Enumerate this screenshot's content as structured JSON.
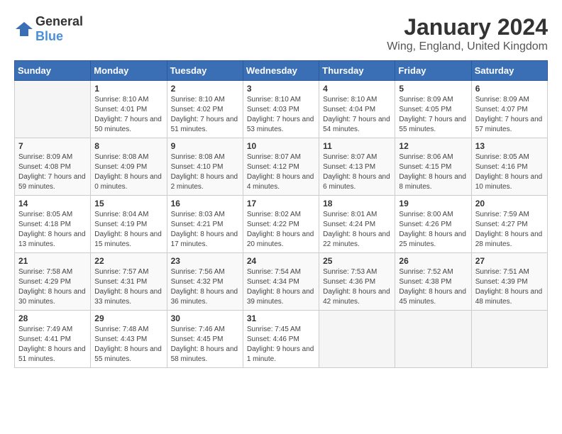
{
  "logo": {
    "general": "General",
    "blue": "Blue"
  },
  "title": "January 2024",
  "subtitle": "Wing, England, United Kingdom",
  "days_of_week": [
    "Sunday",
    "Monday",
    "Tuesday",
    "Wednesday",
    "Thursday",
    "Friday",
    "Saturday"
  ],
  "weeks": [
    [
      {
        "day": "",
        "sunrise": "",
        "sunset": "",
        "daylight": ""
      },
      {
        "day": "1",
        "sunrise": "Sunrise: 8:10 AM",
        "sunset": "Sunset: 4:01 PM",
        "daylight": "Daylight: 7 hours and 50 minutes."
      },
      {
        "day": "2",
        "sunrise": "Sunrise: 8:10 AM",
        "sunset": "Sunset: 4:02 PM",
        "daylight": "Daylight: 7 hours and 51 minutes."
      },
      {
        "day": "3",
        "sunrise": "Sunrise: 8:10 AM",
        "sunset": "Sunset: 4:03 PM",
        "daylight": "Daylight: 7 hours and 53 minutes."
      },
      {
        "day": "4",
        "sunrise": "Sunrise: 8:10 AM",
        "sunset": "Sunset: 4:04 PM",
        "daylight": "Daylight: 7 hours and 54 minutes."
      },
      {
        "day": "5",
        "sunrise": "Sunrise: 8:09 AM",
        "sunset": "Sunset: 4:05 PM",
        "daylight": "Daylight: 7 hours and 55 minutes."
      },
      {
        "day": "6",
        "sunrise": "Sunrise: 8:09 AM",
        "sunset": "Sunset: 4:07 PM",
        "daylight": "Daylight: 7 hours and 57 minutes."
      }
    ],
    [
      {
        "day": "7",
        "sunrise": "Sunrise: 8:09 AM",
        "sunset": "Sunset: 4:08 PM",
        "daylight": "Daylight: 7 hours and 59 minutes."
      },
      {
        "day": "8",
        "sunrise": "Sunrise: 8:08 AM",
        "sunset": "Sunset: 4:09 PM",
        "daylight": "Daylight: 8 hours and 0 minutes."
      },
      {
        "day": "9",
        "sunrise": "Sunrise: 8:08 AM",
        "sunset": "Sunset: 4:10 PM",
        "daylight": "Daylight: 8 hours and 2 minutes."
      },
      {
        "day": "10",
        "sunrise": "Sunrise: 8:07 AM",
        "sunset": "Sunset: 4:12 PM",
        "daylight": "Daylight: 8 hours and 4 minutes."
      },
      {
        "day": "11",
        "sunrise": "Sunrise: 8:07 AM",
        "sunset": "Sunset: 4:13 PM",
        "daylight": "Daylight: 8 hours and 6 minutes."
      },
      {
        "day": "12",
        "sunrise": "Sunrise: 8:06 AM",
        "sunset": "Sunset: 4:15 PM",
        "daylight": "Daylight: 8 hours and 8 minutes."
      },
      {
        "day": "13",
        "sunrise": "Sunrise: 8:05 AM",
        "sunset": "Sunset: 4:16 PM",
        "daylight": "Daylight: 8 hours and 10 minutes."
      }
    ],
    [
      {
        "day": "14",
        "sunrise": "Sunrise: 8:05 AM",
        "sunset": "Sunset: 4:18 PM",
        "daylight": "Daylight: 8 hours and 13 minutes."
      },
      {
        "day": "15",
        "sunrise": "Sunrise: 8:04 AM",
        "sunset": "Sunset: 4:19 PM",
        "daylight": "Daylight: 8 hours and 15 minutes."
      },
      {
        "day": "16",
        "sunrise": "Sunrise: 8:03 AM",
        "sunset": "Sunset: 4:21 PM",
        "daylight": "Daylight: 8 hours and 17 minutes."
      },
      {
        "day": "17",
        "sunrise": "Sunrise: 8:02 AM",
        "sunset": "Sunset: 4:22 PM",
        "daylight": "Daylight: 8 hours and 20 minutes."
      },
      {
        "day": "18",
        "sunrise": "Sunrise: 8:01 AM",
        "sunset": "Sunset: 4:24 PM",
        "daylight": "Daylight: 8 hours and 22 minutes."
      },
      {
        "day": "19",
        "sunrise": "Sunrise: 8:00 AM",
        "sunset": "Sunset: 4:26 PM",
        "daylight": "Daylight: 8 hours and 25 minutes."
      },
      {
        "day": "20",
        "sunrise": "Sunrise: 7:59 AM",
        "sunset": "Sunset: 4:27 PM",
        "daylight": "Daylight: 8 hours and 28 minutes."
      }
    ],
    [
      {
        "day": "21",
        "sunrise": "Sunrise: 7:58 AM",
        "sunset": "Sunset: 4:29 PM",
        "daylight": "Daylight: 8 hours and 30 minutes."
      },
      {
        "day": "22",
        "sunrise": "Sunrise: 7:57 AM",
        "sunset": "Sunset: 4:31 PM",
        "daylight": "Daylight: 8 hours and 33 minutes."
      },
      {
        "day": "23",
        "sunrise": "Sunrise: 7:56 AM",
        "sunset": "Sunset: 4:32 PM",
        "daylight": "Daylight: 8 hours and 36 minutes."
      },
      {
        "day": "24",
        "sunrise": "Sunrise: 7:54 AM",
        "sunset": "Sunset: 4:34 PM",
        "daylight": "Daylight: 8 hours and 39 minutes."
      },
      {
        "day": "25",
        "sunrise": "Sunrise: 7:53 AM",
        "sunset": "Sunset: 4:36 PM",
        "daylight": "Daylight: 8 hours and 42 minutes."
      },
      {
        "day": "26",
        "sunrise": "Sunrise: 7:52 AM",
        "sunset": "Sunset: 4:38 PM",
        "daylight": "Daylight: 8 hours and 45 minutes."
      },
      {
        "day": "27",
        "sunrise": "Sunrise: 7:51 AM",
        "sunset": "Sunset: 4:39 PM",
        "daylight": "Daylight: 8 hours and 48 minutes."
      }
    ],
    [
      {
        "day": "28",
        "sunrise": "Sunrise: 7:49 AM",
        "sunset": "Sunset: 4:41 PM",
        "daylight": "Daylight: 8 hours and 51 minutes."
      },
      {
        "day": "29",
        "sunrise": "Sunrise: 7:48 AM",
        "sunset": "Sunset: 4:43 PM",
        "daylight": "Daylight: 8 hours and 55 minutes."
      },
      {
        "day": "30",
        "sunrise": "Sunrise: 7:46 AM",
        "sunset": "Sunset: 4:45 PM",
        "daylight": "Daylight: 8 hours and 58 minutes."
      },
      {
        "day": "31",
        "sunrise": "Sunrise: 7:45 AM",
        "sunset": "Sunset: 4:46 PM",
        "daylight": "Daylight: 9 hours and 1 minute."
      },
      {
        "day": "",
        "sunrise": "",
        "sunset": "",
        "daylight": ""
      },
      {
        "day": "",
        "sunrise": "",
        "sunset": "",
        "daylight": ""
      },
      {
        "day": "",
        "sunrise": "",
        "sunset": "",
        "daylight": ""
      }
    ]
  ]
}
